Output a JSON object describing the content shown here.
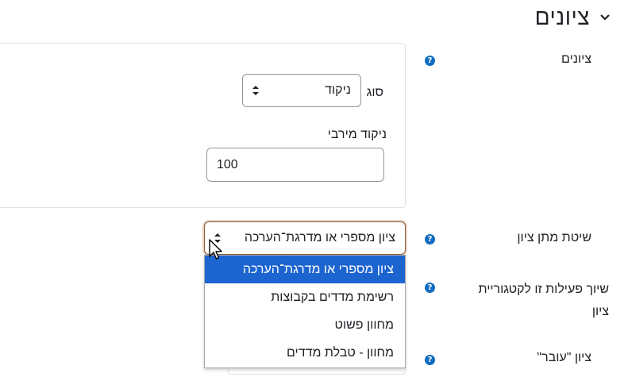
{
  "section": {
    "title": "ציונים"
  },
  "grades": {
    "label": "ציונים",
    "type_label": "סוג",
    "type_value": "ניקוד",
    "max_points_label": "ניקוד מירבי",
    "max_points_value": "100"
  },
  "grade_method": {
    "label": "שיטת מתן ציון",
    "selected": "ציון מספרי או מדרגת־הערכה",
    "options": [
      "ציון מספרי או מדרגת־הערכה",
      "רשימת מדדים בקבוצות",
      "מחוון פשוט",
      "מחוון - טבלת מדדים"
    ]
  },
  "grade_category": {
    "label_line1": "שיוך פעילות זו לקטגוריית",
    "label_line2": "ציון"
  },
  "pass_grade": {
    "label": "ציון \"עובר\""
  },
  "help_glyph": "?",
  "colors": {
    "accent": "#0f6cbf",
    "selected_option": "#1c64d0",
    "focus_border": "#8c5a3a"
  }
}
